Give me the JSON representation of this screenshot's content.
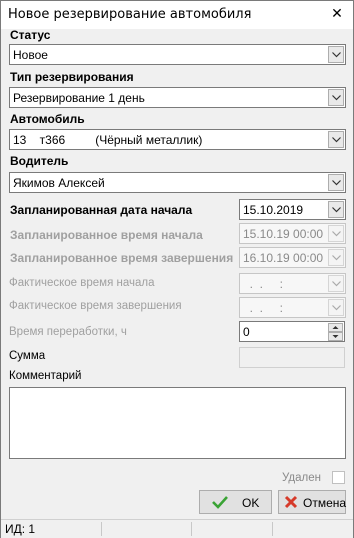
{
  "window": {
    "title": "Новое резервирование автомобиля"
  },
  "status": {
    "label": "Статус",
    "value": "Новое"
  },
  "reservation_type": {
    "label": "Тип резервирования",
    "value": "Резервирование 1 день"
  },
  "car": {
    "label": "Автомобиль",
    "value": "13    т366         (Чёрный металлик)"
  },
  "driver": {
    "label": "Водитель",
    "value": "Якимов Алексей"
  },
  "planned_start_date": {
    "label": "Запланированная дата начала",
    "value": "15.10.2019"
  },
  "planned_start_time": {
    "label": "Запланированное время начала",
    "value": "15.10.19 00:00"
  },
  "planned_end_time": {
    "label": "Запланированное время завершения",
    "value": "16.10.19 00:00"
  },
  "actual_start_time": {
    "label": "Фактическое время начала",
    "value": "  .  .     :"
  },
  "actual_end_time": {
    "label": "Фактическое время завершения",
    "value": "  .  .     :"
  },
  "overtime": {
    "label": "Время переработки, ч",
    "value": "0"
  },
  "sum": {
    "label": "Сумма",
    "value": ""
  },
  "comment": {
    "label": "Комментарий",
    "value": ""
  },
  "deleted": {
    "label": "Удален",
    "checked": false
  },
  "buttons": {
    "ok": "OK",
    "cancel": "Отмена"
  },
  "statusbar": {
    "id_text": "ИД: 1"
  },
  "colors": {
    "ok_check": "#3aa335",
    "cancel_x": "#d63a2a"
  }
}
